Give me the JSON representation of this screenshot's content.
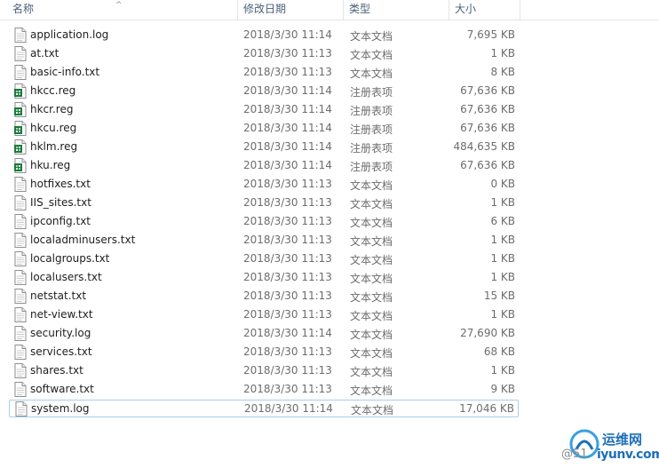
{
  "columns": {
    "name": "名称",
    "modified": "修改日期",
    "type": "类型",
    "size": "大小"
  },
  "files": [
    {
      "name": "application.log",
      "modified": "2018/3/30 11:14",
      "type": "文本文档",
      "size": "7,695 KB",
      "icon": "text-file-icon"
    },
    {
      "name": "at.txt",
      "modified": "2018/3/30 11:13",
      "type": "文本文档",
      "size": "1 KB",
      "icon": "text-file-icon"
    },
    {
      "name": "basic-info.txt",
      "modified": "2018/3/30 11:13",
      "type": "文本文档",
      "size": "8 KB",
      "icon": "text-file-icon"
    },
    {
      "name": "hkcc.reg",
      "modified": "2018/3/30 11:14",
      "type": "注册表项",
      "size": "67,636 KB",
      "icon": "registry-file-icon"
    },
    {
      "name": "hkcr.reg",
      "modified": "2018/3/30 11:14",
      "type": "注册表项",
      "size": "67,636 KB",
      "icon": "registry-file-icon"
    },
    {
      "name": "hkcu.reg",
      "modified": "2018/3/30 11:14",
      "type": "注册表项",
      "size": "67,636 KB",
      "icon": "registry-file-icon"
    },
    {
      "name": "hklm.reg",
      "modified": "2018/3/30 11:14",
      "type": "注册表项",
      "size": "484,635 KB",
      "icon": "registry-file-icon"
    },
    {
      "name": "hku.reg",
      "modified": "2018/3/30 11:14",
      "type": "注册表项",
      "size": "67,636 KB",
      "icon": "registry-file-icon"
    },
    {
      "name": "hotfixes.txt",
      "modified": "2018/3/30 11:13",
      "type": "文本文档",
      "size": "0 KB",
      "icon": "text-file-icon"
    },
    {
      "name": "IIS_sites.txt",
      "modified": "2018/3/30 11:13",
      "type": "文本文档",
      "size": "1 KB",
      "icon": "text-file-icon"
    },
    {
      "name": "ipconfig.txt",
      "modified": "2018/3/30 11:13",
      "type": "文本文档",
      "size": "6 KB",
      "icon": "text-file-icon"
    },
    {
      "name": "localadminusers.txt",
      "modified": "2018/3/30 11:13",
      "type": "文本文档",
      "size": "1 KB",
      "icon": "text-file-icon"
    },
    {
      "name": "localgroups.txt",
      "modified": "2018/3/30 11:13",
      "type": "文本文档",
      "size": "1 KB",
      "icon": "text-file-icon"
    },
    {
      "name": "localusers.txt",
      "modified": "2018/3/30 11:13",
      "type": "文本文档",
      "size": "1 KB",
      "icon": "text-file-icon"
    },
    {
      "name": "netstat.txt",
      "modified": "2018/3/30 11:13",
      "type": "文本文档",
      "size": "15 KB",
      "icon": "text-file-icon"
    },
    {
      "name": "net-view.txt",
      "modified": "2018/3/30 11:13",
      "type": "文本文档",
      "size": "1 KB",
      "icon": "text-file-icon"
    },
    {
      "name": "security.log",
      "modified": "2018/3/30 11:14",
      "type": "文本文档",
      "size": "27,690 KB",
      "icon": "text-file-icon"
    },
    {
      "name": "services.txt",
      "modified": "2018/3/30 11:13",
      "type": "文本文档",
      "size": "68 KB",
      "icon": "text-file-icon"
    },
    {
      "name": "shares.txt",
      "modified": "2018/3/30 11:13",
      "type": "文本文档",
      "size": "1 KB",
      "icon": "text-file-icon"
    },
    {
      "name": "software.txt",
      "modified": "2018/3/30 11:13",
      "type": "文本文档",
      "size": "9 KB",
      "icon": "text-file-icon"
    },
    {
      "name": "system.log",
      "modified": "2018/3/30 11:14",
      "type": "文本文档",
      "size": "17,046 KB",
      "icon": "text-file-icon",
      "selected": true
    }
  ],
  "watermark": {
    "cn": "运维网",
    "en": "iyunv.com",
    "prefix": "@51"
  },
  "colors": {
    "header_text": "#4c607a",
    "selection_border": "#a7cdf0",
    "registry_icon": "#1c7a3c",
    "watermark": "#1d6fb8"
  }
}
